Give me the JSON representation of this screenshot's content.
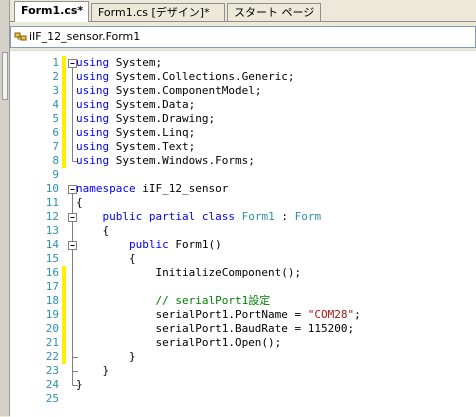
{
  "tabs": [
    {
      "label": "Form1.cs*",
      "active": true
    },
    {
      "label": "Form1.cs [デザイン]*",
      "active": false
    },
    {
      "label": "スタート ページ",
      "active": false
    }
  ],
  "navbar": {
    "type_dropdown": "iIF_12_sensor.Form1",
    "icon": "class-icon"
  },
  "colors": {
    "keyword": "#0000ff",
    "type": "#2b91af",
    "comment": "#008000",
    "string": "#a31515",
    "change_saved": "#ffef00"
  },
  "editor": {
    "lines": [
      {
        "n": "1",
        "fold": "minus",
        "change": "saved",
        "parts": [
          {
            "c": "kw",
            "t": "using"
          },
          {
            "c": "",
            "t": " System;"
          }
        ]
      },
      {
        "n": "2",
        "fold": "line",
        "change": "saved",
        "parts": [
          {
            "c": "kw",
            "t": "using"
          },
          {
            "c": "",
            "t": " System.Collections.Generic;"
          }
        ]
      },
      {
        "n": "3",
        "fold": "line",
        "change": "saved",
        "parts": [
          {
            "c": "kw",
            "t": "using"
          },
          {
            "c": "",
            "t": " System.ComponentModel;"
          }
        ]
      },
      {
        "n": "4",
        "fold": "line",
        "change": "saved",
        "parts": [
          {
            "c": "kw",
            "t": "using"
          },
          {
            "c": "",
            "t": " System.Data;"
          }
        ]
      },
      {
        "n": "5",
        "fold": "line",
        "change": "saved",
        "parts": [
          {
            "c": "kw",
            "t": "using"
          },
          {
            "c": "",
            "t": " System.Drawing;"
          }
        ]
      },
      {
        "n": "6",
        "fold": "line",
        "change": "saved",
        "parts": [
          {
            "c": "kw",
            "t": "using"
          },
          {
            "c": "",
            "t": " System.Linq;"
          }
        ]
      },
      {
        "n": "7",
        "fold": "line",
        "change": "saved",
        "parts": [
          {
            "c": "kw",
            "t": "using"
          },
          {
            "c": "",
            "t": " System.Text;"
          }
        ]
      },
      {
        "n": "8",
        "fold": "end",
        "change": "saved",
        "parts": [
          {
            "c": "kw",
            "t": "using"
          },
          {
            "c": "",
            "t": " System.Windows.Forms;"
          }
        ]
      },
      {
        "n": "9",
        "fold": "",
        "change": "",
        "parts": []
      },
      {
        "n": "10",
        "fold": "minus",
        "change": "",
        "parts": [
          {
            "c": "kw",
            "t": "namespace"
          },
          {
            "c": "",
            "t": " iIF_12_sensor"
          }
        ]
      },
      {
        "n": "11",
        "fold": "line",
        "change": "",
        "parts": [
          {
            "c": "",
            "t": "{"
          }
        ]
      },
      {
        "n": "12",
        "fold": "minus",
        "change": "",
        "parts": [
          {
            "c": "",
            "t": "    "
          },
          {
            "c": "kw",
            "t": "public"
          },
          {
            "c": "",
            "t": " "
          },
          {
            "c": "kw",
            "t": "partial"
          },
          {
            "c": "",
            "t": " "
          },
          {
            "c": "kw",
            "t": "class"
          },
          {
            "c": "",
            "t": " "
          },
          {
            "c": "ty",
            "t": "Form1"
          },
          {
            "c": "",
            "t": " : "
          },
          {
            "c": "ty",
            "t": "Form"
          }
        ]
      },
      {
        "n": "13",
        "fold": "line",
        "change": "",
        "parts": [
          {
            "c": "",
            "t": "    {"
          }
        ]
      },
      {
        "n": "14",
        "fold": "minus",
        "change": "",
        "parts": [
          {
            "c": "",
            "t": "        "
          },
          {
            "c": "kw",
            "t": "public"
          },
          {
            "c": "",
            "t": " Form1()"
          }
        ]
      },
      {
        "n": "15",
        "fold": "line",
        "change": "",
        "parts": [
          {
            "c": "",
            "t": "        {"
          }
        ]
      },
      {
        "n": "16",
        "fold": "line",
        "change": "saved",
        "parts": [
          {
            "c": "",
            "t": "            InitializeComponent();"
          }
        ]
      },
      {
        "n": "17",
        "fold": "line",
        "change": "saved",
        "parts": []
      },
      {
        "n": "18",
        "fold": "line",
        "change": "saved",
        "parts": [
          {
            "c": "",
            "t": "            "
          },
          {
            "c": "cm",
            "t": "// serialPort1設定"
          }
        ]
      },
      {
        "n": "19",
        "fold": "line",
        "change": "saved",
        "parts": [
          {
            "c": "",
            "t": "            serialPort1.PortName = "
          },
          {
            "c": "st",
            "t": "\"COM28\""
          },
          {
            "c": "",
            "t": ";"
          }
        ]
      },
      {
        "n": "20",
        "fold": "line",
        "change": "saved",
        "parts": [
          {
            "c": "",
            "t": "            serialPort1.BaudRate = 115200;"
          }
        ]
      },
      {
        "n": "21",
        "fold": "line",
        "change": "saved",
        "parts": [
          {
            "c": "",
            "t": "            serialPort1.Open();"
          }
        ]
      },
      {
        "n": "22",
        "fold": "end",
        "change": "saved",
        "parts": [
          {
            "c": "",
            "t": "        }"
          }
        ]
      },
      {
        "n": "23",
        "fold": "end",
        "change": "",
        "parts": [
          {
            "c": "",
            "t": "    }"
          }
        ]
      },
      {
        "n": "24",
        "fold": "end",
        "change": "",
        "parts": [
          {
            "c": "",
            "t": "}"
          }
        ]
      },
      {
        "n": "25",
        "fold": "",
        "change": "",
        "parts": []
      }
    ]
  }
}
